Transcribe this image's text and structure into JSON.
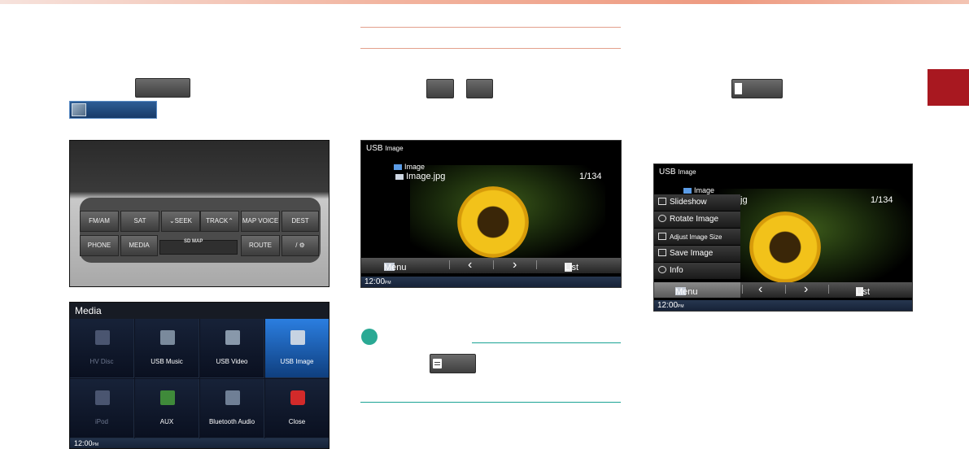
{
  "colors": {
    "accent_red": "#a81820",
    "teal": "#1aa394",
    "rule_red": "#e3a08c"
  },
  "left": {
    "media_button_chip": "",
    "usb_image_chip": "",
    "radio_panel": {
      "buttons": [
        "FM/AM",
        "SAT",
        "⌄SEEK",
        "TRACK⌃",
        "MAP VOICE",
        "DEST",
        "PHONE",
        "MEDIA",
        "ROUTE",
        "/ ⚙"
      ],
      "slot_label": "SD MAP"
    },
    "media_screen": {
      "title": "Media",
      "items": [
        "HV Disc",
        "USB Music",
        "USB Video",
        "USB Image",
        "iPod",
        "AUX",
        "Bluetooth Audio",
        "Close"
      ],
      "clock": "12:00",
      "clock_suffix": "PM"
    }
  },
  "middle": {
    "screen": {
      "title": "USB",
      "subtitle": "Image",
      "folder": "Image",
      "file": "Image.jpg",
      "count": "1/134",
      "menu_label": "Menu",
      "prev_glyph": "‹",
      "next_glyph": "›",
      "list_label": "List",
      "clock": "12:00",
      "clock_suffix": "PM"
    }
  },
  "right": {
    "screen": {
      "title": "USB",
      "subtitle": "Image",
      "folder": "Image",
      "file_fragment": "jg",
      "count": "1/134",
      "popup": [
        "Slideshow",
        "Rotate Image",
        "Adjust Image Size",
        "Save Image",
        "Info"
      ],
      "menu_label": "Menu",
      "prev_glyph": "‹",
      "next_glyph": "›",
      "list_label": "List",
      "clock": "12:00",
      "clock_suffix": "PM"
    }
  }
}
